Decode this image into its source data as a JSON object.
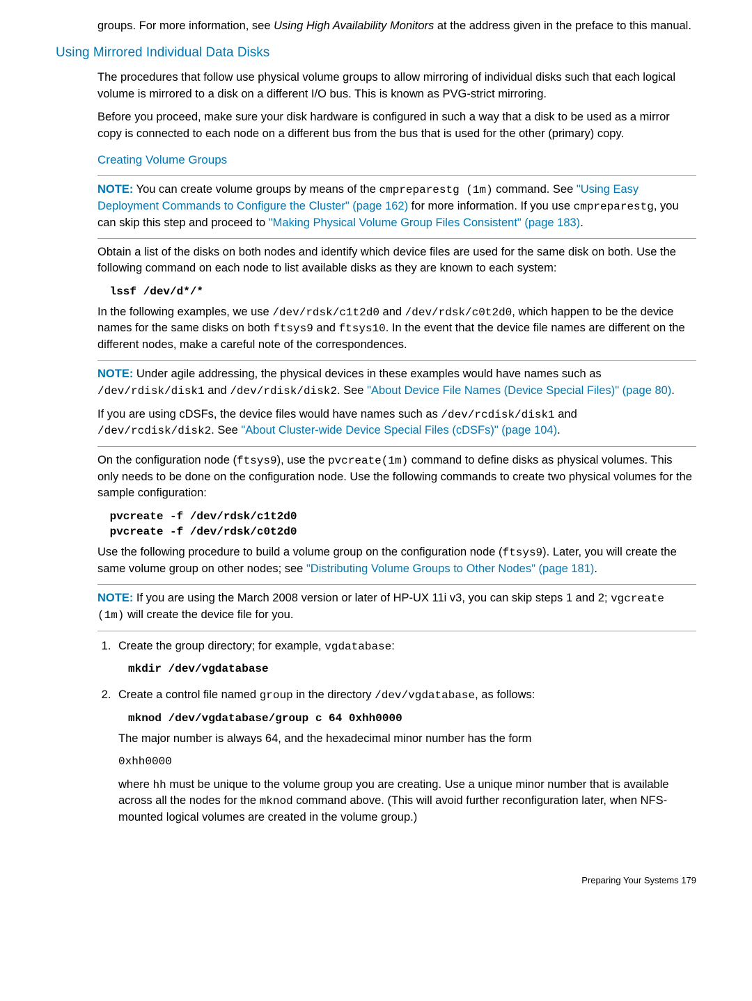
{
  "intro": {
    "p1a": "groups. For more information, see ",
    "p1b": "Using High Availability Monitors",
    "p1c": " at the address given in the preface to this manual."
  },
  "h3": "Using Mirrored Individual Data Disks",
  "s1": {
    "p1": "The procedures that follow use physical volume groups to allow mirroring of individual disks such that each logical volume is mirrored to a disk on a different I/O bus. This is known as PVG-strict mirroring.",
    "p2": "Before you proceed, make sure your disk hardware is configured in such a way that a disk to be used as a mirror copy is connected to each node on a different bus from the bus that is used for the other (primary) copy."
  },
  "h4": "Creating Volume Groups",
  "note1": {
    "label": "NOTE:",
    "a": "   You can create volume groups by means of the ",
    "b": "cmpreparestg (1m)",
    "c": " command. See ",
    "link1": "\"Using Easy Deployment Commands to Configure the Cluster\" (page 162)",
    "d": " for more information. If you use ",
    "e": "cmpreparestg",
    "f": ", you can skip this step and proceed to ",
    "link2": "\"Making Physical Volume Group Files Consistent\" (page 183)",
    "g": "."
  },
  "s2": {
    "p1": "Obtain a list of the disks on both nodes and identify which device files are used for the same disk on both. Use the following command on each node to list available disks as they are known to each system:"
  },
  "code1": " lssf /dev/d*/*",
  "s3": {
    "a": "In the following examples, we use ",
    "b": "/dev/rdsk/c1t2d0",
    "c": " and ",
    "d": "/dev/rdsk/c0t2d0",
    "e": ", which happen to be the device names for the same disks on both ",
    "f": "ftsys9",
    "g": " and ",
    "h": "ftsys10",
    "i": ". In the event that the device file names are different on the different nodes, make a careful note of the correspondences."
  },
  "note2": {
    "label": "NOTE:",
    "a": "   Under agile addressing, the physical devices in these examples would have names such as ",
    "b": "/dev/rdisk/disk1",
    "c": " and ",
    "d": "/dev/rdisk/disk2",
    "e": ". See ",
    "link1": "\"About Device File Names (Device Special Files)\" (page 80)",
    "f": "."
  },
  "s4": {
    "a": "If you are using cDSFs, the device files would have names such as ",
    "b": "/dev/rcdisk/disk1",
    "c": " and ",
    "d": "/dev/rcdisk/disk2",
    "e": ". See ",
    "link1": "\"About Cluster-wide Device Special Files (cDSFs)\" (page 104)",
    "f": "."
  },
  "s5": {
    "a": "On the configuration node (",
    "b": "ftsys9",
    "c": "), use the ",
    "d": "pvcreate(1m)",
    "e": " command to define disks as physical volumes. This only needs to be done on the configuration node. Use the following commands to create two physical volumes for the sample configuration:"
  },
  "code2": " pvcreate -f /dev/rdsk/c1t2d0\n pvcreate -f /dev/rdsk/c0t2d0",
  "s6": {
    "a": "Use the following procedure to build a volume group on the configuration node (",
    "b": "ftsys9",
    "c": "). Later, you will create the same volume group on other nodes; see ",
    "link1": "\"Distributing Volume Groups to Other Nodes\" (page 181)",
    "d": "."
  },
  "note3": {
    "label": "NOTE:",
    "a": "   If you are using the March 2008 version or later of HP-UX 11i v3, you can skip steps 1 and 2; ",
    "b": "vgcreate (1m)",
    "c": " will create the device file for you."
  },
  "li1": {
    "a": "Create the group directory; for example, ",
    "b": "vgdatabase",
    "c": ":",
    "code": "mkdir /dev/vgdatabase"
  },
  "li2": {
    "a": "Create a control file named ",
    "b": "group",
    "c": " in the directory ",
    "d": "/dev/vgdatabase",
    "e": ", as follows:",
    "code": "mknod /dev/vgdatabase/group c 64 0xhh0000",
    "p2": "The major number is always 64, and the hexadecimal minor number has the form",
    "p3": "0xhh0000",
    "p4a": "where ",
    "p4b": "hh",
    "p4c": " must be unique to the volume group you are creating. Use a unique minor number that is available across all the nodes for the ",
    "p4d": "mknod",
    "p4e": " command above. (This will avoid further reconfiguration later, when NFS-mounted logical volumes are created in the volume group.)"
  },
  "footer": "Preparing Your Systems    179"
}
